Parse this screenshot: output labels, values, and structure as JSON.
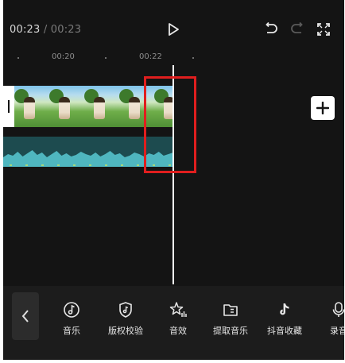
{
  "player": {
    "current_time": "00:23",
    "separator": "/",
    "total_time": "00:23"
  },
  "controls": {
    "play_icon": "play-icon",
    "undo_icon": "undo-icon",
    "redo_icon": "redo-icon",
    "fullscreen_icon": "fullscreen-icon"
  },
  "ruler": {
    "ticks": [
      "00:20",
      "00:22"
    ]
  },
  "colors": {
    "background": "#141414",
    "audio_waveform": "#4fb6bf",
    "highlight": "#e01e1e",
    "toolbar": "#1c1c1c"
  },
  "toolbar": {
    "items": [
      {
        "label": "音乐",
        "icon": "music-note-icon"
      },
      {
        "label": "版权校验",
        "icon": "copyright-shield-icon"
      },
      {
        "label": "音效",
        "icon": "sound-effect-star-icon"
      },
      {
        "label": "提取音乐",
        "icon": "folder-extract-icon"
      },
      {
        "label": "抖音收藏",
        "icon": "tiktok-icon"
      },
      {
        "label": "录音",
        "icon": "microphone-icon"
      }
    ]
  }
}
